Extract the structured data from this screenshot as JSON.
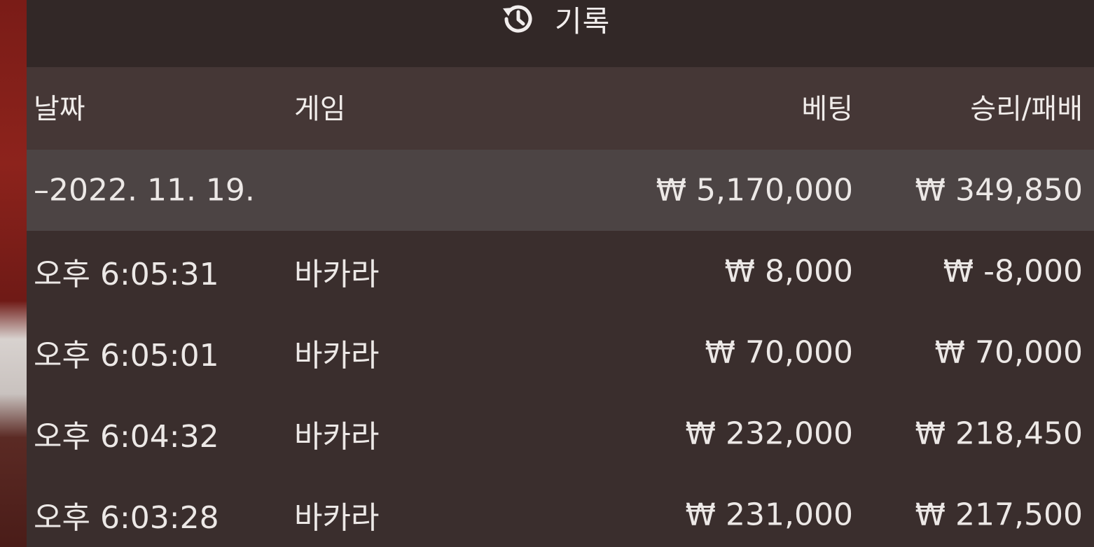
{
  "header": {
    "icon": "history-icon",
    "title": "기록"
  },
  "columns": {
    "date": "날짜",
    "game": "게임",
    "bet": "베팅",
    "win_loss": "승리/패배"
  },
  "date_group": {
    "label": "–2022. 11. 19.",
    "total_bet": "₩ 5,170,000",
    "total_win_loss": "₩ 349,850"
  },
  "rows": [
    {
      "time": "오후 6:05:31",
      "game": "바카라",
      "bet": "₩ 8,000",
      "win_loss": "₩ -8,000"
    },
    {
      "time": "오후 6:05:01",
      "game": "바카라",
      "bet": "₩ 70,000",
      "win_loss": "₩ 70,000"
    },
    {
      "time": "오후 6:04:32",
      "game": "바카라",
      "bet": "₩ 232,000",
      "win_loss": "₩ 218,450"
    },
    {
      "time": "오후 6:03:28",
      "game": "바카라",
      "bet": "₩ 231,000",
      "win_loss": "₩ 217,500"
    }
  ],
  "colors": {
    "panel": "#3a2e2d",
    "header": "#322827",
    "column_header": "#453736",
    "date_row": "#4c4444",
    "text": "#ece8e6"
  }
}
